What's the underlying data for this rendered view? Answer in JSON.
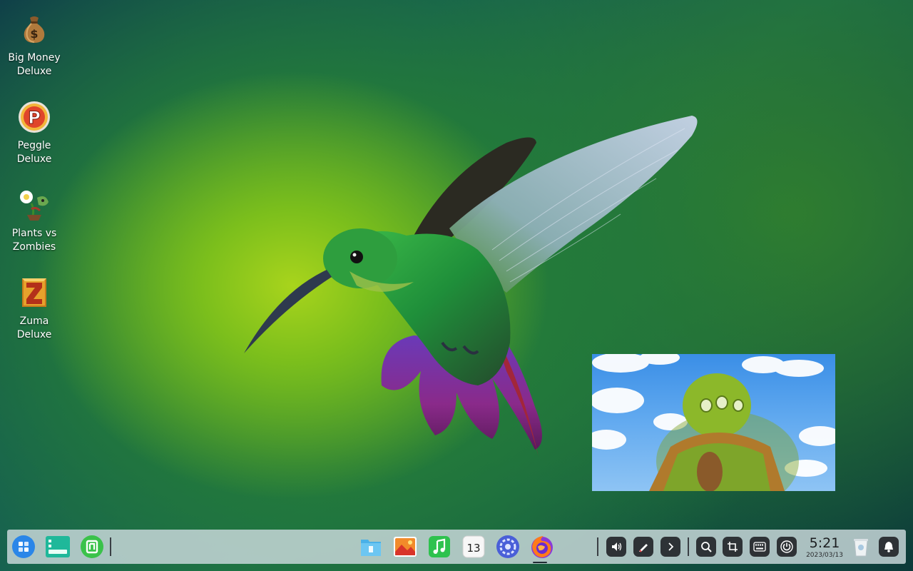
{
  "desktop": {
    "icons": [
      {
        "label": "Big Money\nDeluxe",
        "icon": "money-bag-icon"
      },
      {
        "label": "Peggle\nDeluxe",
        "icon": "peggle-icon"
      },
      {
        "label": "Plants vs\nZombies",
        "icon": "plants-vs-zombies-icon"
      },
      {
        "label": "Zuma\nDeluxe",
        "icon": "zuma-icon"
      }
    ]
  },
  "dock": {
    "left": [
      {
        "icon": "launcher-icon"
      },
      {
        "icon": "multitask-view-icon"
      },
      {
        "icon": "app-store-icon"
      }
    ],
    "center": [
      {
        "icon": "file-manager-icon"
      },
      {
        "icon": "image-viewer-icon"
      },
      {
        "icon": "music-icon"
      },
      {
        "icon": "calendar-icon",
        "day": "13"
      },
      {
        "icon": "control-center-icon"
      },
      {
        "icon": "firefox-icon"
      }
    ],
    "tray": [
      {
        "icon": "volume-icon"
      },
      {
        "icon": "stylus-icon"
      },
      {
        "icon": "chevron-right-icon"
      },
      {
        "icon": "search-icon"
      },
      {
        "icon": "screenshot-icon"
      },
      {
        "icon": "keyboard-icon"
      },
      {
        "icon": "power-icon"
      }
    ],
    "clock": {
      "time": "5:21",
      "date": "2023/03/13"
    },
    "right": [
      {
        "icon": "trash-icon"
      },
      {
        "icon": "notification-bell-icon"
      }
    ]
  },
  "colors": {
    "dock_bg": "#cddade",
    "tray_button": "#2e3236",
    "accent_blue": "#2a86e8"
  }
}
